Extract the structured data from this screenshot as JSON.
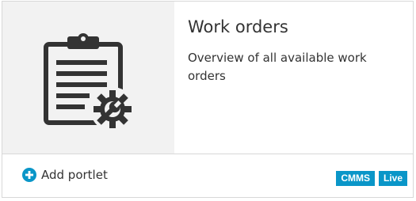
{
  "portlet": {
    "title": "Work orders",
    "description": "Overview of all available work orders",
    "thumbnail_icon": "clipboard-gear-icon"
  },
  "footer": {
    "add_label": "Add portlet",
    "add_icon": "plus-circle-icon",
    "tags": [
      "CMMS",
      "Live"
    ]
  },
  "colors": {
    "accent": "#0a96c8",
    "icon": "#333333",
    "thumbnail_bg": "#f2f2f2",
    "border": "#d8d8d8"
  }
}
